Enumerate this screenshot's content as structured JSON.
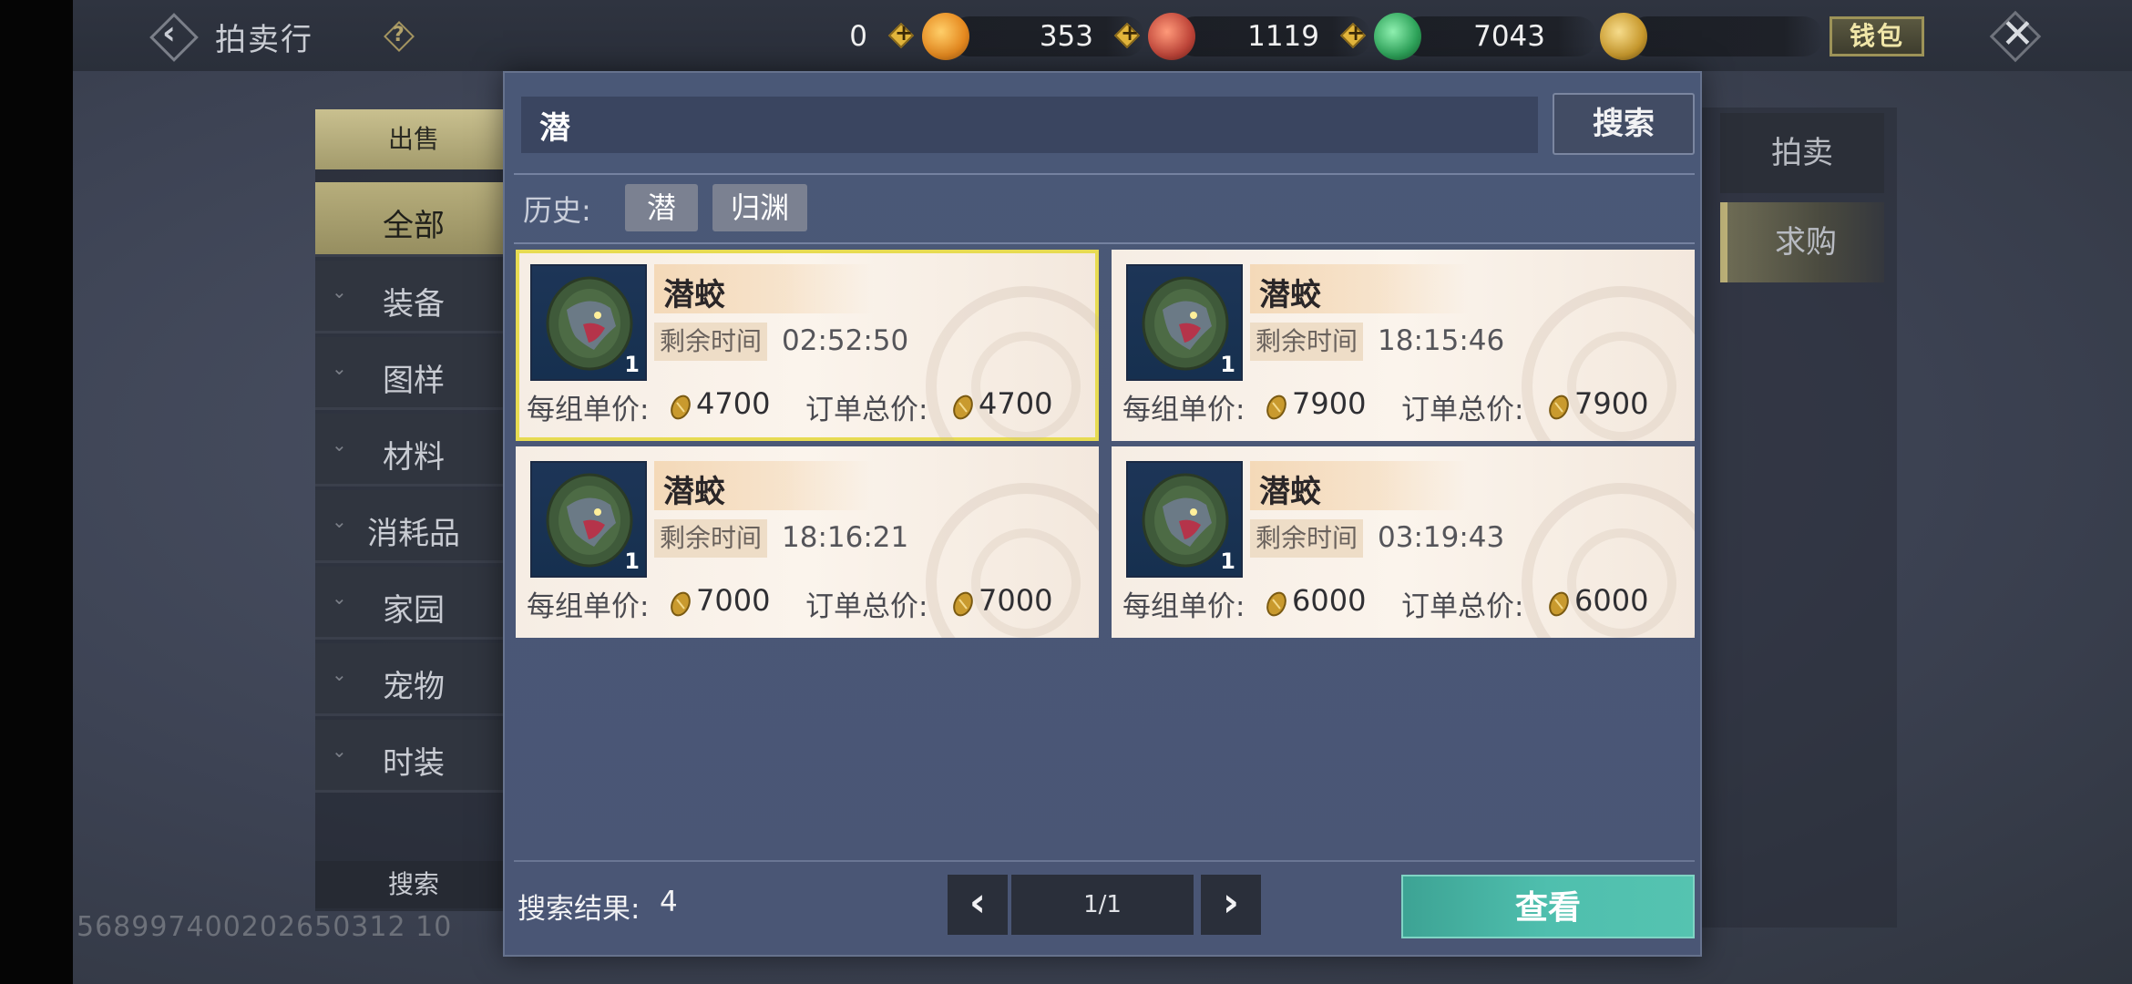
{
  "header": {
    "title": "拍卖行",
    "back_icon": "back-chevron-icon",
    "help_icon": "help-question-icon",
    "currencies": [
      {
        "icon": "gold-ingot-icon",
        "amount": "0",
        "color": "#e68a20"
      },
      {
        "icon": "red-swirl-coin-icon",
        "amount": "353",
        "color": "#c0463a"
      },
      {
        "icon": "jade-coin-icon",
        "amount": "1119",
        "color": "#2ea35a"
      },
      {
        "icon": "golden-seed-coin-icon",
        "amount": "7043",
        "color": "#c99a2e"
      }
    ],
    "wallet_label": "钱包",
    "close_icon": "close-x-icon"
  },
  "categories": {
    "sell_tab": "出售",
    "items": [
      "全部",
      "装备",
      "图样",
      "材料",
      "消耗品",
      "家园",
      "宠物",
      "时装"
    ],
    "search_button": "搜索"
  },
  "right_tabs": {
    "auction": "拍卖",
    "buy_request": "求购"
  },
  "user_id": "568997400202650312 10",
  "search_popup": {
    "input_value": "潜",
    "search_button": "搜索",
    "history_label": "历史:",
    "history": [
      "潜",
      "归渊"
    ],
    "results": [
      {
        "name": "潜蛟",
        "qty": "1",
        "time_label": "剩余时间",
        "time": "02:52:50",
        "unit_label": "每组单价:",
        "unit_price": "4700",
        "total_label": "订单总价:",
        "total_price": "4700",
        "selected": true
      },
      {
        "name": "潜蛟",
        "qty": "1",
        "time_label": "剩余时间",
        "time": "18:15:46",
        "unit_label": "每组单价:",
        "unit_price": "7900",
        "total_label": "订单总价:",
        "total_price": "7900",
        "selected": false
      },
      {
        "name": "潜蛟",
        "qty": "1",
        "time_label": "剩余时间",
        "time": "18:16:21",
        "unit_label": "每组单价:",
        "unit_price": "7000",
        "total_label": "订单总价:",
        "total_price": "7000",
        "selected": false
      },
      {
        "name": "潜蛟",
        "qty": "1",
        "time_label": "剩余时间",
        "time": "03:19:43",
        "unit_label": "每组单价:",
        "unit_price": "6000",
        "total_label": "订单总价:",
        "total_price": "6000",
        "selected": false
      }
    ],
    "result_label": "搜索结果:",
    "result_count": "4",
    "page": "1/1",
    "prev_icon": "chevron-left-icon",
    "next_icon": "chevron-right-icon",
    "view_button": "查看"
  }
}
